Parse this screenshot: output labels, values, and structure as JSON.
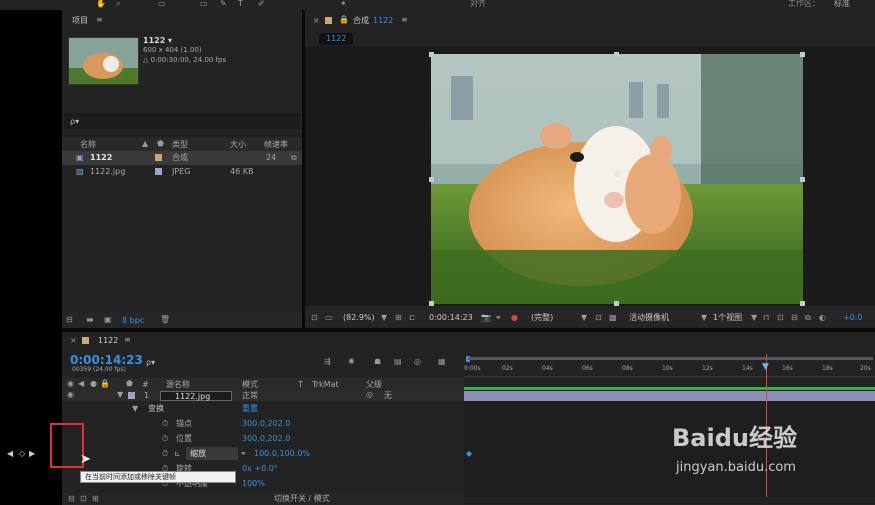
{
  "top_bar": {
    "align_label": "对齐",
    "workspace_label": "工作区：",
    "workspace_value": "标准"
  },
  "project": {
    "panel_title": "项目",
    "item_name": "1122 ▾",
    "item_dims": "600 x 404 (1.00)",
    "item_duration": "△ 0:00:30:00, 24.00 fps",
    "search_placeholder": "ρ▾",
    "columns": {
      "name": "名称",
      "type": "类型",
      "size": "大小",
      "fps": "帧速率"
    },
    "rows": [
      {
        "name": "1122",
        "type": "合成",
        "size": "",
        "fps": "24"
      },
      {
        "name": "1122.jpg",
        "type": "JPEG",
        "size": "46 KB",
        "fps": ""
      }
    ],
    "bpc": "8 bpc"
  },
  "comp": {
    "tab_prefix": "合成",
    "tab_name": "1122",
    "breadcrumb": "1122",
    "zoom": "(82.9%)",
    "timecode": "0:00:14:23",
    "resolution": "(完整)",
    "camera": "活动摄像机",
    "views": "1个视图",
    "exposure": "+0.0"
  },
  "timeline": {
    "tab_name": "1122",
    "timecode": "0:00:14:23",
    "frame_info": "00359 (24.00 fps)",
    "search_placeholder": "ρ▾",
    "col_num": "#",
    "col_source": "源名称",
    "col_mode": "模式",
    "col_t": "T",
    "col_trkmat": "TrkMat",
    "col_parent": "父级",
    "layer": {
      "num": "1",
      "name": "1122.jpg",
      "mode": "正常",
      "parent": "无"
    },
    "transform_label": "变换",
    "reset_label": "重置",
    "props": [
      {
        "name": "锚点",
        "value": "300.0,202.0"
      },
      {
        "name": "位置",
        "value": "300.0,202.0"
      },
      {
        "name": "缩放",
        "value": "100.0,100.0%"
      },
      {
        "name": "旋转",
        "value": "0x +0.0°"
      },
      {
        "name": "不透明度",
        "value": "100%"
      }
    ],
    "ruler": [
      "0:00s",
      "02s",
      "04s",
      "06s",
      "08s",
      "10s",
      "12s",
      "14s",
      "16s",
      "18s",
      "20s"
    ],
    "tooltip": "在当前时间添加或移除关键帧",
    "footer": "切换开关 / 模式"
  },
  "watermark": {
    "brand": "Baidu经验",
    "url": "jingyan.baidu.com"
  },
  "colors": {
    "accent": "#3c8fe0",
    "playhead": "#e0463e",
    "highlight_box": "#e03030",
    "panel": "#232323"
  }
}
